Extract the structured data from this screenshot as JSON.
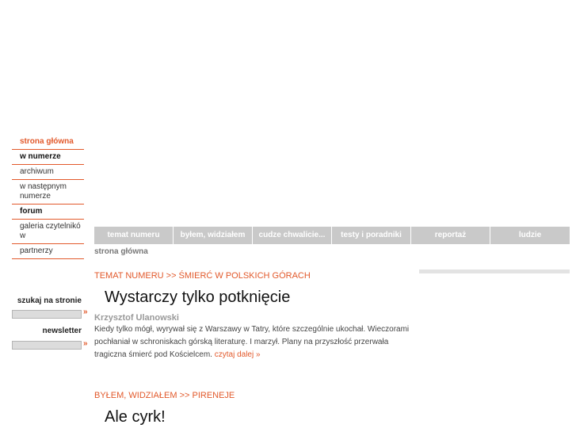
{
  "nav": {
    "items": [
      {
        "label": "strona główna",
        "style": "orange"
      },
      {
        "label": "w numerze",
        "style": "bold"
      },
      {
        "label": "archiwum",
        "style": "plain"
      },
      {
        "label": "w następnym numerze",
        "style": "plain"
      },
      {
        "label": "forum",
        "style": "bold"
      },
      {
        "label": "galeria czytelników",
        "style": "plain"
      },
      {
        "label": "partnerzy",
        "style": "plain"
      }
    ]
  },
  "search": {
    "label": "szukaj na stronie",
    "arrow": "»"
  },
  "newsletter": {
    "label": "newsletter",
    "arrow": "»"
  },
  "tabs": [
    {
      "label": "temat numeru"
    },
    {
      "label": "byłem, widziałem"
    },
    {
      "label": "cudze chwalicie..."
    },
    {
      "label": "testy i poradniki"
    },
    {
      "label": "reportaż"
    },
    {
      "label": "ludzie"
    }
  ],
  "breadcrumb": "strona główna",
  "articles": [
    {
      "section": "TEMAT NUMERU >> ŚMIERĆ W POLSKICH GÓRACH",
      "title": "Wystarczy tylko potknięcie",
      "author": "Krzysztof Ulanowski",
      "lead": "Kiedy tylko mógł, wyrywał się z Warszawy w Tatry, które szczególnie ukochał. Wieczorami pochłaniał w schroniskach górską literaturę. I marzył. Plany na przyszłość przerwała tragiczna śmierć pod Kościelcem.",
      "more": "czytaj dalej »"
    },
    {
      "section": "BYŁEM, WIDZIAŁEM >> PIRENEJE",
      "title": "Ale cyrk!"
    }
  ],
  "colors": {
    "accent": "#e2592b",
    "tab_bg": "#c9c9c9",
    "input_bg": "#dcdcdc"
  }
}
